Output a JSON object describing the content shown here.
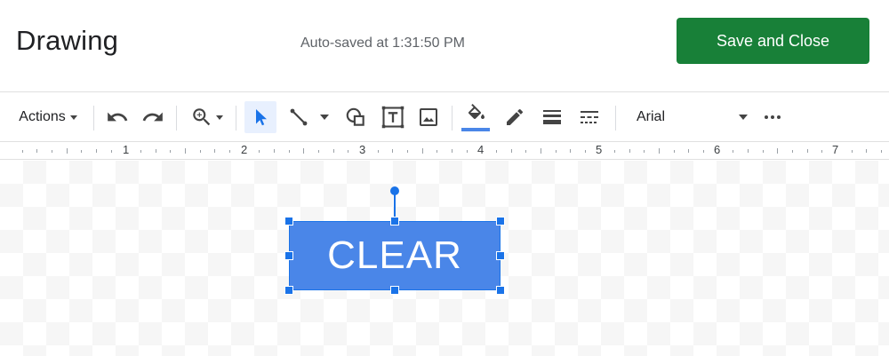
{
  "header": {
    "title": "Drawing",
    "autosave_text": "Auto-saved at 1:31:50 PM",
    "save_close_label": "Save and Close"
  },
  "toolbar": {
    "actions_label": "Actions",
    "font_name": "Arial",
    "icons": [
      "undo-icon",
      "redo-icon",
      "zoom-icon",
      "select-icon",
      "line-icon",
      "shape-icon",
      "text-box-icon",
      "image-icon",
      "fill-color-icon",
      "border-color-icon",
      "border-weight-icon",
      "border-dash-icon",
      "more-icon"
    ],
    "fill_color": "#4a86e8"
  },
  "ruler": {
    "numbers": [
      "1",
      "2",
      "3",
      "4",
      "5",
      "6",
      "7"
    ]
  },
  "canvas": {
    "shape_text": "CLEAR",
    "shape_color": "#4a86e8",
    "selection_color": "#1a73e8"
  },
  "colors": {
    "save_button": "#188038",
    "accent": "#1a73e8"
  }
}
